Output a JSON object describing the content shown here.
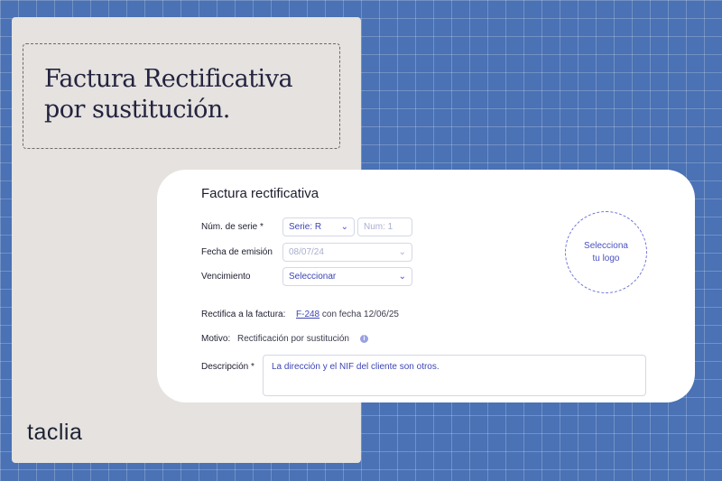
{
  "banner": {
    "title_line1": "Factura Rectificativa",
    "title_line2": "por sustitución.",
    "logo": "taclia"
  },
  "form": {
    "title": "Factura rectificativa",
    "serie_label": "Núm. de serie *",
    "serie_value": "Serie: R",
    "num_placeholder": "Num: 1",
    "fecha_label": "Fecha de emisión",
    "fecha_value": "08/07/24",
    "vencimiento_label": "Vencimiento",
    "vencimiento_value": "Seleccionar",
    "logo_upload_line1": "Selecciona",
    "logo_upload_line2": "tu logo",
    "rectifica_label": "Rectifica a la factura:",
    "rectifica_invoice": "F-248",
    "rectifica_date_text": "con fecha 12/06/25",
    "motivo_label": "Motivo:",
    "motivo_value": "Rectificación por sustitución",
    "descripcion_label": "Descripción *",
    "descripcion_value": "La dirección y el NIF del cliente son otros."
  },
  "icons": {
    "chevron": "chevron-down-icon",
    "info": "info-icon"
  },
  "colors": {
    "background": "#4a72b5",
    "accent": "#3d45b5",
    "panel": "#e5e2df"
  }
}
